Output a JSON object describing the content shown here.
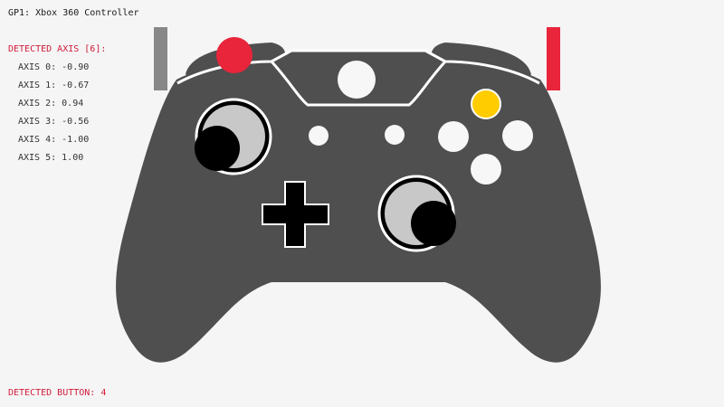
{
  "gamepad": {
    "title": "GP1: Xbox 360 Controller"
  },
  "axes": {
    "header": "DETECTED AXIS [6]:",
    "items": [
      {
        "label": "AXIS 0: -0.90",
        "value": -0.9
      },
      {
        "label": "AXIS 1: -0.67",
        "value": -0.67
      },
      {
        "label": "AXIS 2: 0.94",
        "value": 0.94
      },
      {
        "label": "AXIS 3: -0.56",
        "value": -0.56
      },
      {
        "label": "AXIS 4: -1.00",
        "value": -1.0
      },
      {
        "label": "AXIS 5: 1.00",
        "value": 1.0
      }
    ]
  },
  "buttons": {
    "detected_label": "DETECTED BUTTON: 4",
    "pressed_color": "#e8253b",
    "y_button_color": "#ffcc00"
  },
  "triggers": {
    "left_level": -1.0,
    "right_level": 1.0,
    "left_color": "#888888",
    "right_color": "#e8253b"
  },
  "colors": {
    "body": "#4f4f4f",
    "outline": "#ffffff",
    "accent_red": "#d01d3b",
    "stick_ring": "#c8c8c8",
    "stick_knob": "#000000",
    "button_white": "#f7f7f7"
  }
}
